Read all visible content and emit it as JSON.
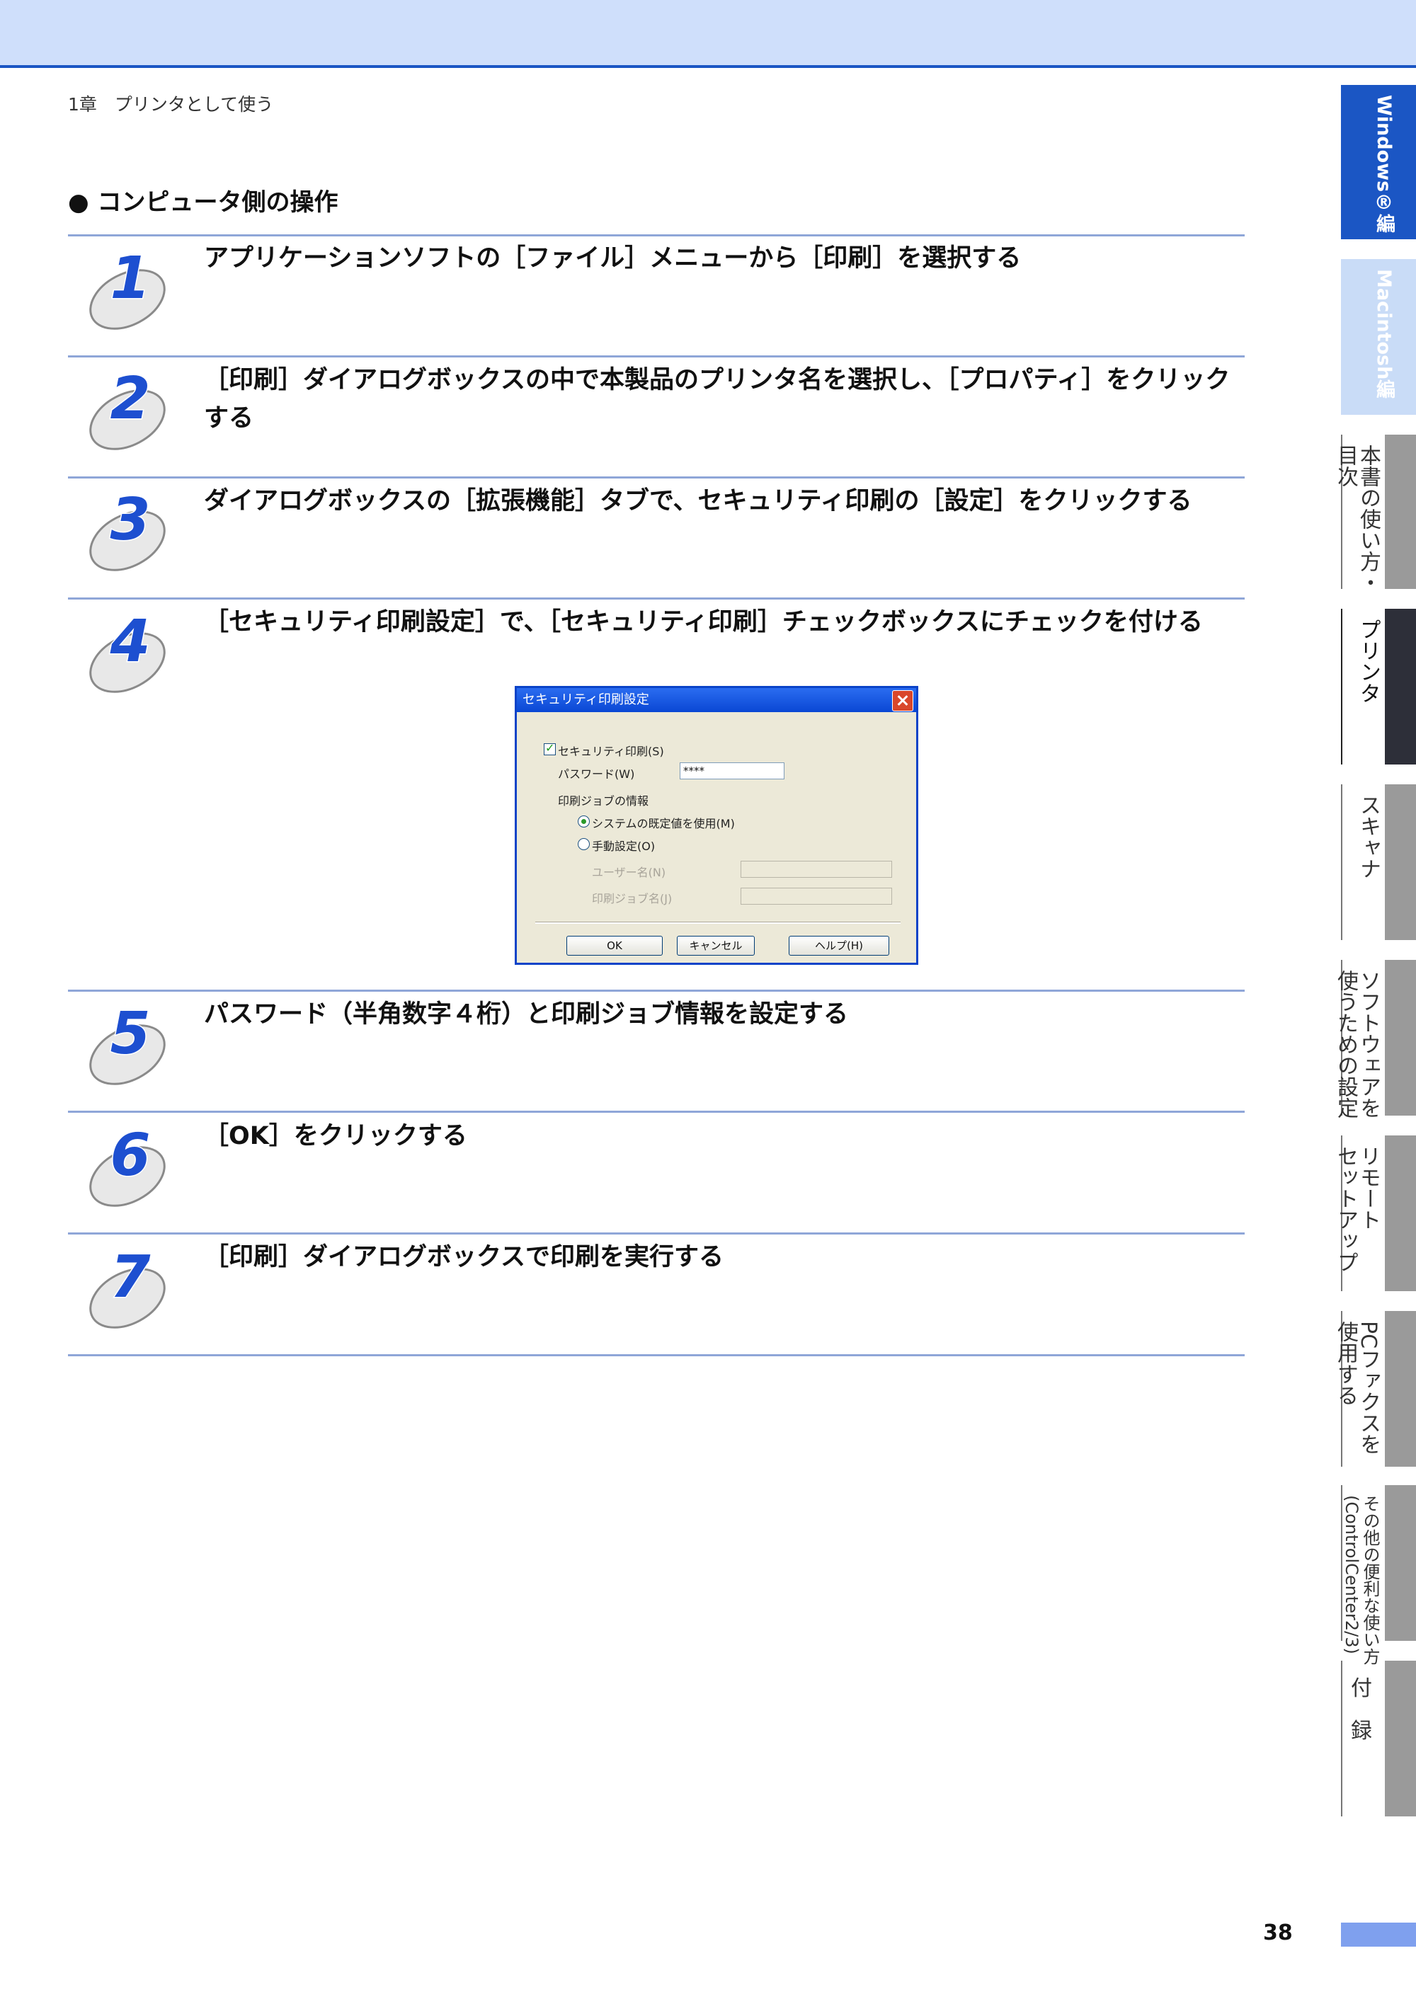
{
  "header": {
    "chapter": "1章　プリンタとして使う"
  },
  "section_title": "● コンピュータ側の操作",
  "steps": [
    {
      "num": "1",
      "text": "アプリケーションソフトの［ファイル］メニューから［印刷］を選択する"
    },
    {
      "num": "2",
      "text": "［印刷］ダイアログボックスの中で本製品のプリンタ名を選択し、［プロパティ］をクリックする"
    },
    {
      "num": "3",
      "text": "ダイアログボックスの［拡張機能］タブで、セキュリティ印刷の［設定］をクリックする"
    },
    {
      "num": "4",
      "text": "［セキュリティ印刷設定］で、［セキュリティ印刷］チェックボックスにチェックを付ける"
    },
    {
      "num": "5",
      "text": "パスワード（半角数字４桁）と印刷ジョブ情報を設定する"
    },
    {
      "num": "6",
      "text": "［OK］をクリックする"
    },
    {
      "num": "7",
      "text": "［印刷］ダイアログボックスで印刷を実行する"
    }
  ],
  "dialog": {
    "title": "セキュリティ印刷設定",
    "security_print_label": "セキュリティ印刷(S)",
    "password_label": "パスワード(W)",
    "password_value": "****",
    "job_info_label": "印刷ジョブの情報",
    "use_default_label": "システムの既定値を使用(M)",
    "manual_label": "手動設定(O)",
    "user_name_label": "ユーザー名(N)",
    "job_name_label": "印刷ジョブ名(J)",
    "ok": "OK",
    "cancel": "キャンセル",
    "help": "ヘルプ(H)"
  },
  "side_tabs": [
    {
      "label": "Windows®編",
      "style": "active-win"
    },
    {
      "label": "Macintosh編",
      "style": "mac"
    },
    {
      "label": "本書の使い方・\n目次",
      "style": "gray"
    },
    {
      "label": "プリンタ",
      "style": "dark"
    },
    {
      "label": "スキャナ",
      "style": "gray"
    },
    {
      "label": "ソフトウェアを\n使うための設定",
      "style": "gray"
    },
    {
      "label": "リモート\nセットアップ",
      "style": "gray"
    },
    {
      "label": "PCファクスを\n使用する",
      "style": "gray"
    },
    {
      "label": "その他の便利な使い方\n(ControlCenter2/3)",
      "style": "gray"
    },
    {
      "label": "付\n録",
      "style": "gray"
    }
  ],
  "page_number": "38"
}
